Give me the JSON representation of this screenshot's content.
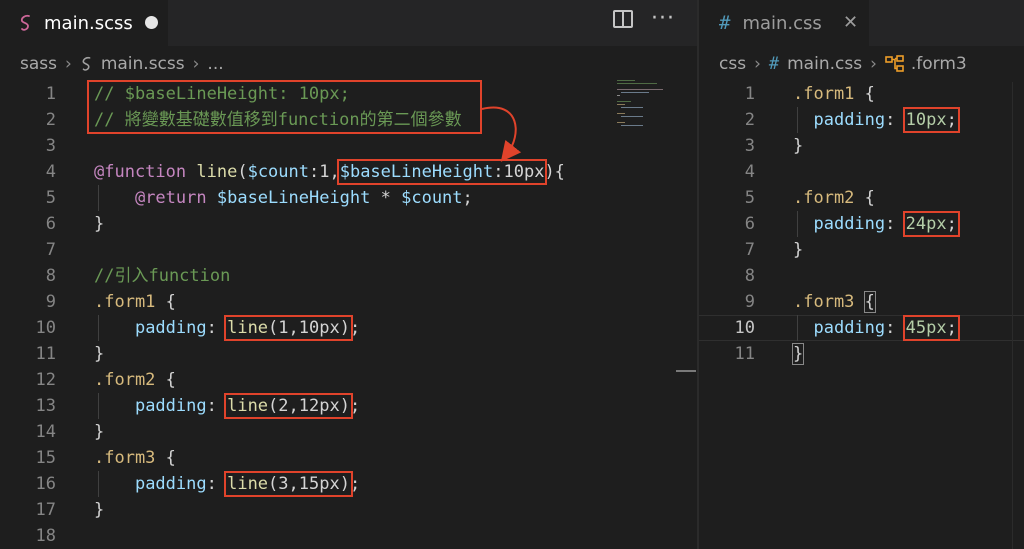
{
  "left_pane": {
    "tab": {
      "title": "main.scss",
      "unsaved": true
    },
    "breadcrumb": {
      "folder": "sass",
      "file": "main.scss",
      "more": "..."
    },
    "lines": [
      {
        "n": "1",
        "tokens": [
          [
            "comment",
            "// $baseLineHeight: 10px;"
          ]
        ]
      },
      {
        "n": "2",
        "tokens": [
          [
            "comment",
            "// 將變數基礎數值移到function的第二個參數"
          ]
        ]
      },
      {
        "n": "3",
        "tokens": []
      },
      {
        "n": "4",
        "tokens": [
          [
            "at",
            "@function"
          ],
          [
            "plain",
            " "
          ],
          [
            "fn",
            "line"
          ],
          [
            "plain",
            "("
          ],
          [
            "var",
            "$count"
          ],
          [
            "plain",
            ":1,"
          ],
          [
            "var",
            "$baseLineHeight"
          ],
          [
            "plain",
            ":10px"
          ],
          [
            "plain",
            "){"
          ]
        ]
      },
      {
        "n": "5",
        "tokens": [
          [
            "plain",
            "    "
          ],
          [
            "at",
            "@return"
          ],
          [
            "plain",
            " "
          ],
          [
            "var",
            "$baseLineHeight"
          ],
          [
            "plain",
            " * "
          ],
          [
            "var",
            "$count"
          ],
          [
            "plain",
            ";"
          ]
        ]
      },
      {
        "n": "6",
        "tokens": [
          [
            "plain",
            "}"
          ]
        ]
      },
      {
        "n": "7",
        "tokens": []
      },
      {
        "n": "8",
        "tokens": [
          [
            "comment",
            "//引入function"
          ]
        ]
      },
      {
        "n": "9",
        "tokens": [
          [
            "sel",
            ".form1"
          ],
          [
            "plain",
            " {"
          ]
        ]
      },
      {
        "n": "10",
        "tokens": [
          [
            "plain",
            "    "
          ],
          [
            "var",
            "padding"
          ],
          [
            "plain",
            ": "
          ],
          [
            "fn",
            "line"
          ],
          [
            "plain",
            "(1,10px)"
          ],
          [
            "plain",
            ";"
          ]
        ]
      },
      {
        "n": "11",
        "tokens": [
          [
            "plain",
            "}"
          ]
        ]
      },
      {
        "n": "12",
        "tokens": [
          [
            "sel",
            ".form2"
          ],
          [
            "plain",
            " {"
          ]
        ]
      },
      {
        "n": "13",
        "tokens": [
          [
            "plain",
            "    "
          ],
          [
            "var",
            "padding"
          ],
          [
            "plain",
            ": "
          ],
          [
            "fn",
            "line"
          ],
          [
            "plain",
            "(2,12px)"
          ],
          [
            "plain",
            ";"
          ]
        ]
      },
      {
        "n": "14",
        "tokens": [
          [
            "plain",
            "}"
          ]
        ]
      },
      {
        "n": "15",
        "tokens": [
          [
            "sel",
            ".form3"
          ],
          [
            "plain",
            " {"
          ]
        ]
      },
      {
        "n": "16",
        "tokens": [
          [
            "plain",
            "    "
          ],
          [
            "var",
            "padding"
          ],
          [
            "plain",
            ": "
          ],
          [
            "fn",
            "line"
          ],
          [
            "plain",
            "(3,15px)"
          ],
          [
            "plain",
            ";"
          ]
        ]
      },
      {
        "n": "17",
        "tokens": [
          [
            "plain",
            "}"
          ]
        ]
      },
      {
        "n": "18",
        "tokens": []
      }
    ]
  },
  "right_pane": {
    "tab": {
      "title": "main.css"
    },
    "breadcrumb": {
      "folder": "css",
      "file": "main.css",
      "symbol": ".form3"
    },
    "active_line": "10",
    "lines": [
      {
        "n": "1",
        "tokens": [
          [
            "sel",
            ".form1"
          ],
          [
            "plain",
            " {"
          ]
        ]
      },
      {
        "n": "2",
        "tokens": [
          [
            "plain",
            "  "
          ],
          [
            "var",
            "padding"
          ],
          [
            "plain",
            ": "
          ],
          [
            "num",
            "10px"
          ],
          [
            "plain",
            ";"
          ]
        ]
      },
      {
        "n": "3",
        "tokens": [
          [
            "plain",
            "}"
          ]
        ]
      },
      {
        "n": "4",
        "tokens": []
      },
      {
        "n": "5",
        "tokens": [
          [
            "sel",
            ".form2"
          ],
          [
            "plain",
            " {"
          ]
        ]
      },
      {
        "n": "6",
        "tokens": [
          [
            "plain",
            "  "
          ],
          [
            "var",
            "padding"
          ],
          [
            "plain",
            ": "
          ],
          [
            "num",
            "24px"
          ],
          [
            "plain",
            ";"
          ]
        ]
      },
      {
        "n": "7",
        "tokens": [
          [
            "plain",
            "}"
          ]
        ]
      },
      {
        "n": "8",
        "tokens": []
      },
      {
        "n": "9",
        "tokens": [
          [
            "sel",
            ".form3"
          ],
          [
            "plain",
            " {"
          ]
        ]
      },
      {
        "n": "10",
        "tokens": [
          [
            "plain",
            "  "
          ],
          [
            "var",
            "padding"
          ],
          [
            "plain",
            ": "
          ],
          [
            "num",
            "45px"
          ],
          [
            "plain",
            ";"
          ]
        ]
      },
      {
        "n": "11",
        "tokens": [
          [
            "plain",
            "}"
          ]
        ]
      }
    ]
  },
  "colors": {
    "annotation": "#e0432b",
    "comment": "#6a9955",
    "at_rule": "#c586c0",
    "function": "#dcdcaa",
    "variable": "#9cdcfe",
    "selector": "#d7ba7d",
    "number": "#b5cea8"
  },
  "icons": {
    "sass_file": "sass-icon",
    "css_file": "css-hash-icon",
    "split_editor": "split-editor-icon",
    "more_actions": "more-actions-icon",
    "close_tab": "close-icon",
    "symbol_class": "symbol-class-icon"
  }
}
